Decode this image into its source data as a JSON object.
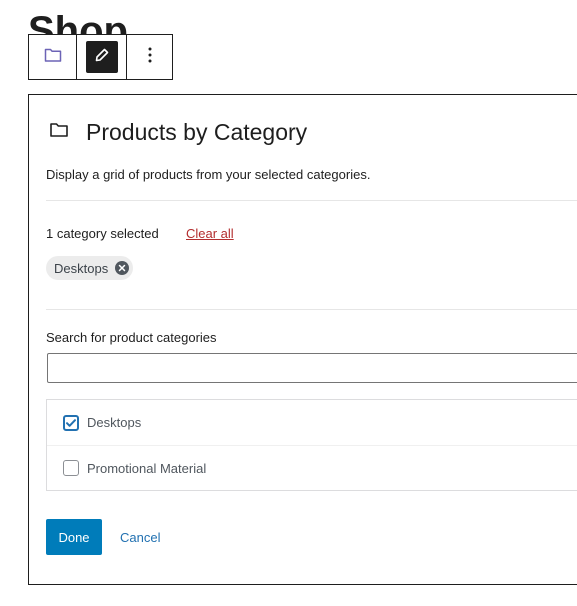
{
  "page": {
    "title": "Shop"
  },
  "toolbar": {
    "block_icon": "folder-icon",
    "edit_icon": "pencil-icon",
    "more_icon": "more-vertical-icon"
  },
  "panel": {
    "icon": "folder-icon",
    "title": "Products by Category",
    "description": "Display a grid of products from your selected categories.",
    "selected_count": "1 category selected",
    "clear_all_label": "Clear all",
    "selected_chips": [
      {
        "label": "Desktops"
      }
    ],
    "search_label": "Search for product categories",
    "search_value": "",
    "categories": [
      {
        "label": "Desktops",
        "checked": true
      },
      {
        "label": "Promotional Material",
        "checked": false
      }
    ],
    "done_label": "Done",
    "cancel_label": "Cancel"
  },
  "colors": {
    "accent": "#007cba",
    "link": "#2271b1",
    "danger": "#b32d2e",
    "text": "#1e1e1e"
  }
}
